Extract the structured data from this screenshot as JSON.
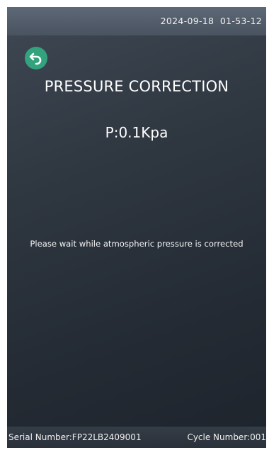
{
  "status_bar": {
    "date": "2024-09-18",
    "time": "01-53-12"
  },
  "header": {
    "back_icon": "undo-arrow-icon",
    "title": "PRESSURE CORRECTION"
  },
  "main": {
    "pressure_readout": "P:0.1Kpa",
    "wait_message": "Please wait while atmospheric pressure is corrected"
  },
  "footer": {
    "serial": "Serial Number:FP22LB2409001",
    "cycle": "Cycle Number:001"
  },
  "colors": {
    "back_button": "#33a37e",
    "background": "#2a313a",
    "status_bar": "#55606d"
  }
}
